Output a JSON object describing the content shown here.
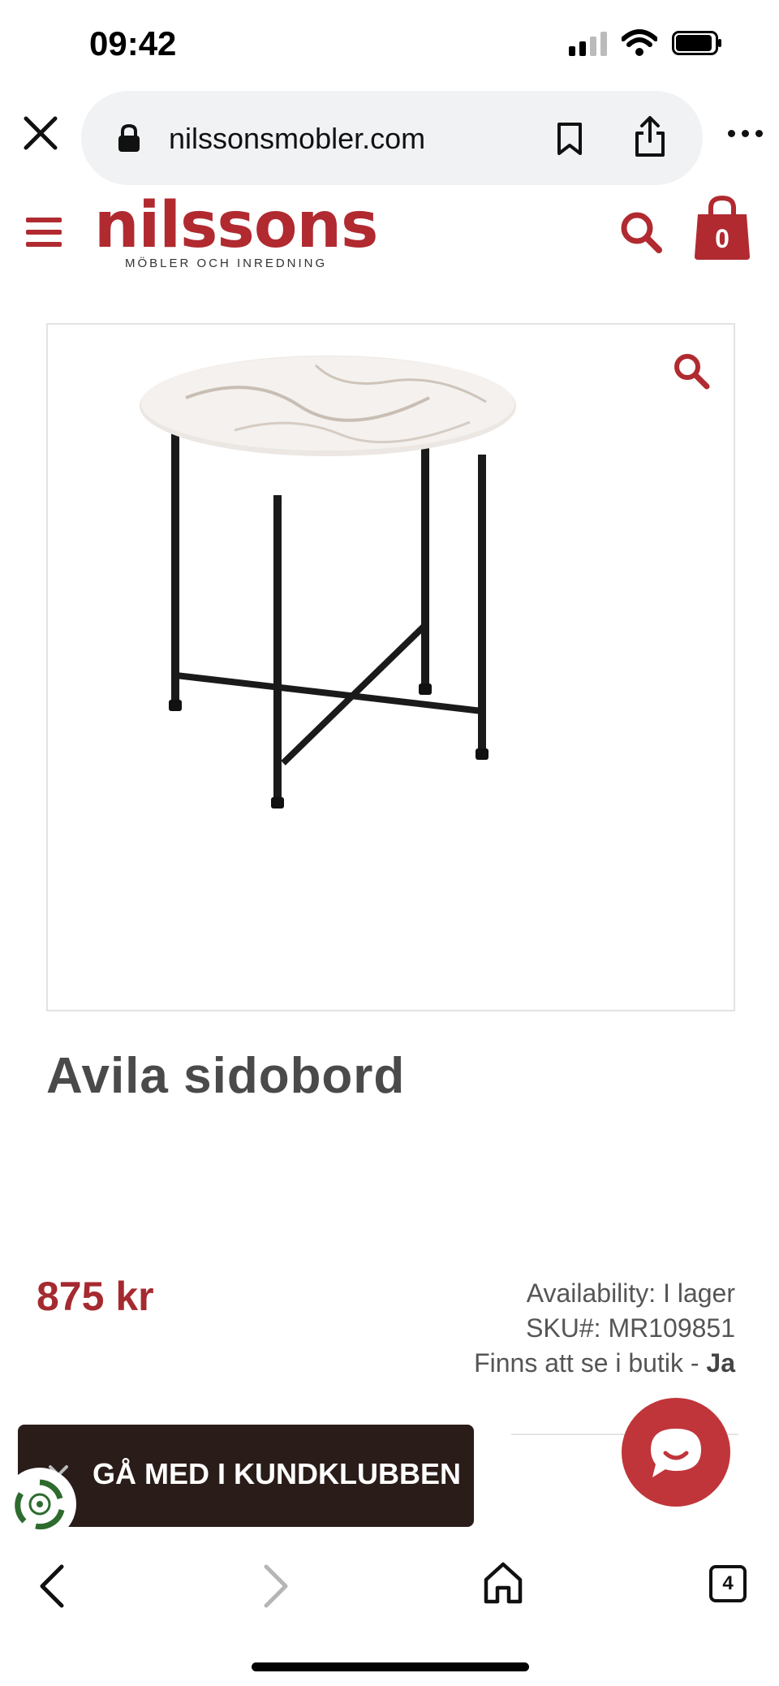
{
  "status_bar": {
    "time": "09:42"
  },
  "browser": {
    "url": "nilssonsmobler.com",
    "tab_count": "4"
  },
  "site": {
    "logo_word": "nilssons",
    "logo_tagline": "MÖBLER OCH INREDNING",
    "cart_count": "0"
  },
  "product": {
    "title": "Avila sidobord",
    "price": "875 kr",
    "availability_label": "Availability:",
    "availability_value": "I lager",
    "sku_label": "SKU#:",
    "sku_value": "MR109851",
    "in_store_label": "Finns att se i butik -",
    "in_store_value": "Ja"
  },
  "club_banner": {
    "text": "GÅ MED I KUNDKLUBBEN"
  },
  "colors": {
    "brand_red": "#b02a30",
    "banner_dark": "#2a1c18",
    "chat_red": "#c0353a"
  },
  "icons": [
    "close-icon",
    "lock-icon",
    "bookmark-icon",
    "share-icon",
    "more-icon",
    "hamburger-icon",
    "search-icon",
    "cart-icon",
    "zoom-icon",
    "chat-icon",
    "recycle-icon",
    "back-icon",
    "forward-icon",
    "home-icon",
    "tabs-icon"
  ]
}
